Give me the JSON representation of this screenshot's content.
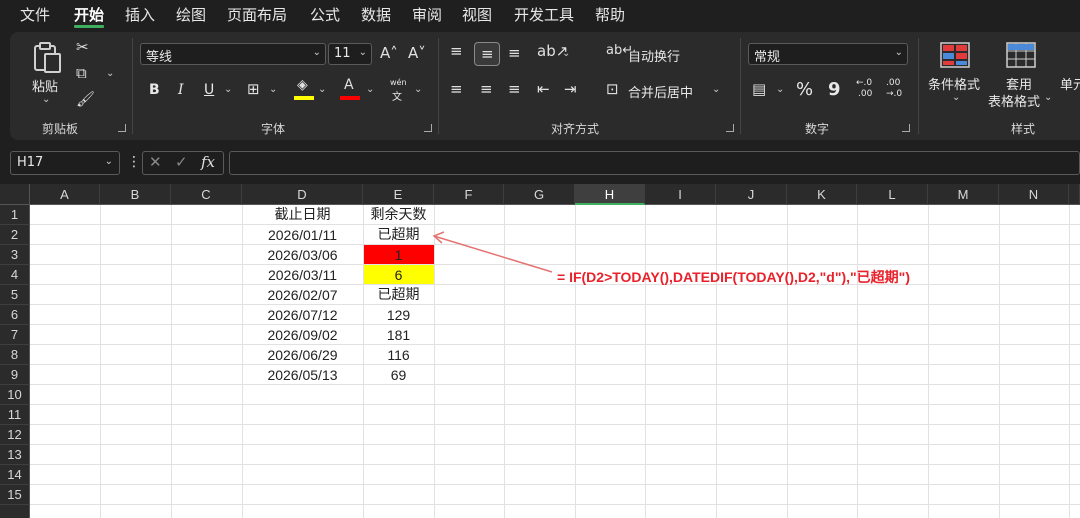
{
  "menu": [
    "文件",
    "开始",
    "插入",
    "绘图",
    "页面布局",
    "公式",
    "数据",
    "审阅",
    "视图",
    "开发工具",
    "帮助"
  ],
  "ribbon": {
    "clipboard": {
      "paste": "粘贴",
      "label": "剪贴板"
    },
    "font": {
      "name": "等线",
      "size": "11",
      "label": "字体",
      "bold": "B",
      "italic": "I",
      "underline": "U",
      "phonetic_top": "wén",
      "phonetic_bottom": "文",
      "fill_color": "#ffff00",
      "font_color": "#ff0000"
    },
    "alignment": {
      "wrap": "自动换行",
      "merge": "合并后居中",
      "label": "对齐方式"
    },
    "number": {
      "format": "常规",
      "percent": "%",
      "comma": "9",
      "label": "数字",
      "inc_dec_1": "←.0",
      "inc_dec_2": ".00",
      "dec_dec_1": ".00",
      "dec_dec_2": "→.0"
    },
    "styles": {
      "conditional": "条件格式",
      "table_line1": "套用",
      "table_line2": "表格格式",
      "cell_partial": "单元",
      "label": "样式"
    }
  },
  "formula_bar": {
    "name_box": "H17",
    "fx": "fx",
    "content": ""
  },
  "sheet": {
    "columns": [
      "A",
      "B",
      "C",
      "D",
      "E",
      "F",
      "G",
      "H",
      "I",
      "J",
      "K",
      "L",
      "M",
      "N"
    ],
    "rows": [
      "1",
      "2",
      "3",
      "4",
      "5",
      "6",
      "7",
      "8",
      "9",
      "10",
      "11",
      "12",
      "13",
      "14",
      "15"
    ],
    "header": {
      "d": "截止日期",
      "e": "剩余天数"
    },
    "data": [
      {
        "date": "2026/01/11",
        "days": "已超期"
      },
      {
        "date": "2026/03/06",
        "days": "1"
      },
      {
        "date": "2026/03/11",
        "days": "6"
      },
      {
        "date": "2026/02/07",
        "days": "已超期"
      },
      {
        "date": "2026/07/12",
        "days": "129"
      },
      {
        "date": "2026/09/02",
        "days": "181"
      },
      {
        "date": "2026/06/29",
        "days": "116"
      },
      {
        "date": "2026/05/13",
        "days": "69"
      }
    ],
    "highlight_colors": {
      "row3": "#ff0000",
      "row4": "#ffff00"
    }
  },
  "annotation": "= IF(D2>TODAY(),DATEDIF(TODAY(),D2,\"d\"),\"已超期\")"
}
